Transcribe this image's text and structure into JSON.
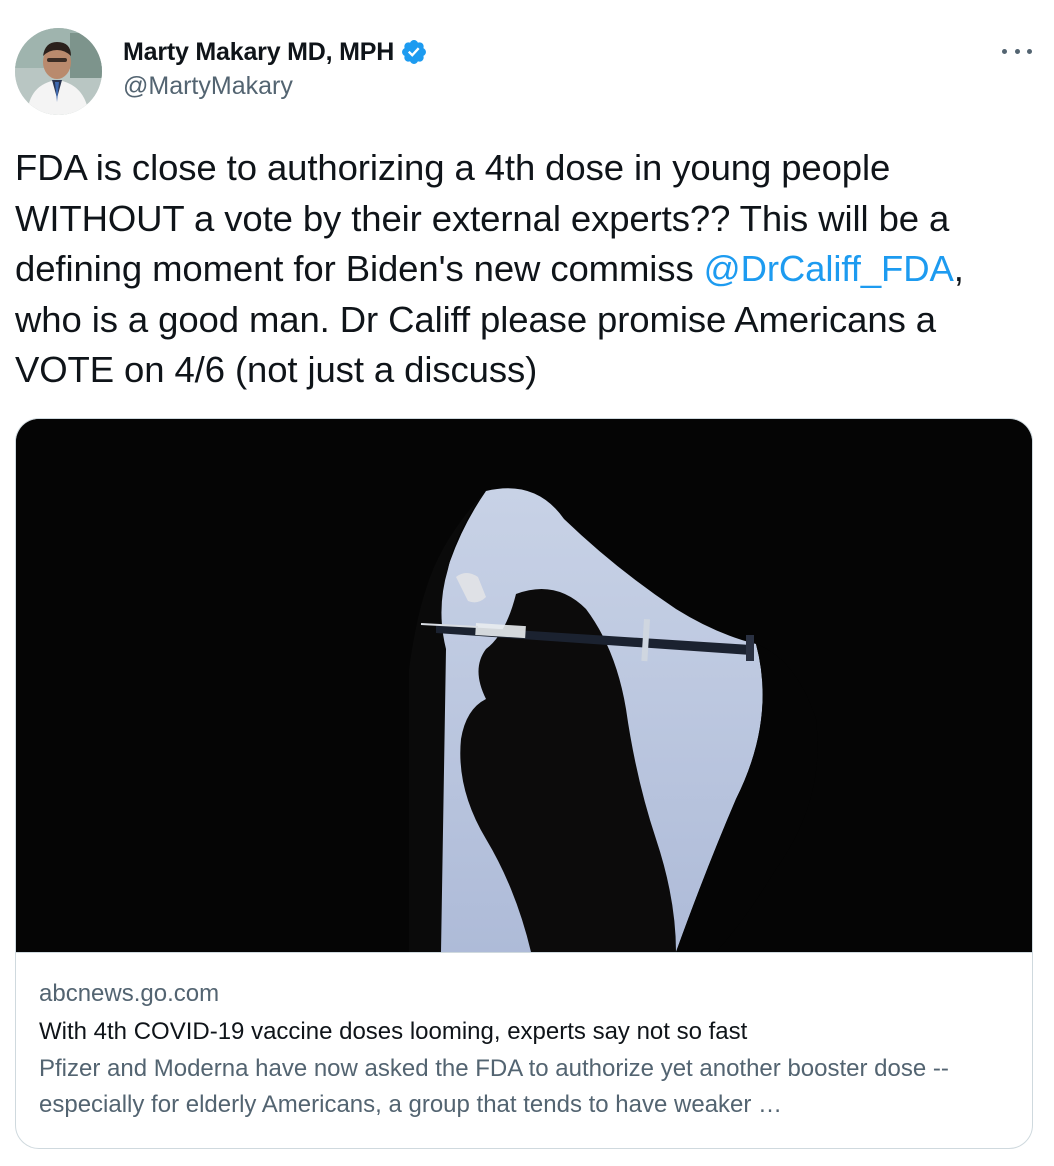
{
  "author": {
    "display_name": "Marty Makary MD, MPH",
    "handle": "@MartyMakary",
    "verified": true,
    "avatar_icon": "profile-photo"
  },
  "menu": {
    "icon": "more-horizontal-icon"
  },
  "tweet": {
    "text_before": "FDA is close to authorizing a 4th dose in young people WITHOUT a vote by their external experts?? This will be a defining moment for Biden's new commiss ",
    "mention": "@DrCaliff_FDA",
    "text_after": ", who is a good man. Dr Califf please promise Americans a VOTE on 4/6 (not just a discuss)"
  },
  "link_card": {
    "image_icon": "vaccine-syringe-photo",
    "domain": "abcnews.go.com",
    "title": "With 4th COVID-19 vaccine doses looming, experts say not so fast",
    "description": "Pfizer and Moderna have now asked the FDA to authorize yet another booster dose -- especially for elderly Americans, a group that tends to have weaker …"
  },
  "colors": {
    "accent": "#1d9bf0",
    "text_primary": "#0f1419",
    "text_secondary": "#536471",
    "border": "#cfd9de"
  }
}
